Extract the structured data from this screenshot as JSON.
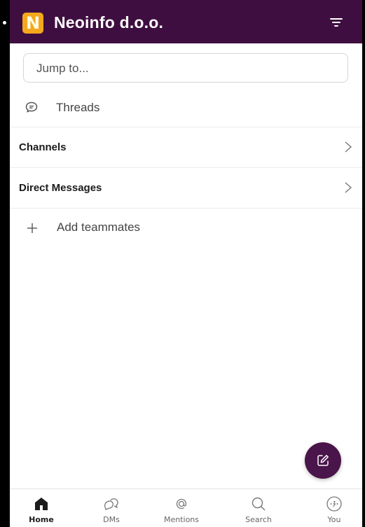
{
  "header": {
    "logo_letter": "N",
    "workspace_name": "Neoinfo d.o.o.",
    "icon": "filter-icon"
  },
  "search": {
    "placeholder": "Jump to..."
  },
  "threads": {
    "icon": "threads-icon",
    "label": "Threads"
  },
  "sections": [
    {
      "label": "Channels",
      "icon": "chevron-right-icon"
    },
    {
      "label": "Direct Messages",
      "icon": "chevron-right-icon"
    }
  ],
  "add_teammates": {
    "icon": "plus-icon",
    "label": "Add teammates"
  },
  "compose": {
    "icon": "compose-icon"
  },
  "nav": [
    {
      "label": "Home",
      "icon": "home-icon",
      "active": true
    },
    {
      "label": "DMs",
      "icon": "dms-icon",
      "active": false
    },
    {
      "label": "Mentions",
      "icon": "mentions-icon",
      "active": false
    },
    {
      "label": "Search",
      "icon": "search-icon",
      "active": false
    },
    {
      "label": "You",
      "icon": "you-icon",
      "active": false
    }
  ],
  "colors": {
    "header_bg": "#3f0e40",
    "logo_bg": "#f4a81d",
    "fab_bg": "#4a154b"
  }
}
